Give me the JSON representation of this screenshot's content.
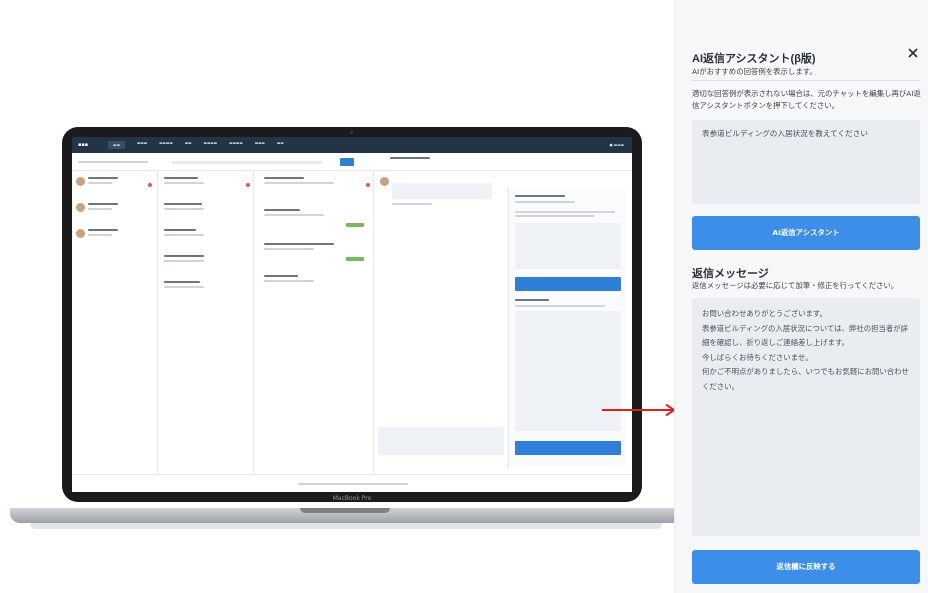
{
  "panel": {
    "title": "AI返信アシスタント(β版)",
    "subtitle": "AIがおすすめの回答例を表示します。",
    "notice": "適切な回答例が表示されない場合は、元のチャットを編集し再びAI返信アシスタントボタンを押下してください。",
    "question": "表参道ビルディングの入居状況を教えてください",
    "ai_button": "AI返信アシスタント",
    "reply_heading": "返信メッセージ",
    "reply_sub": "返信メッセージは必要に応じて加筆・修正を行ってください。",
    "reply_lines": [
      "お問い合わせありがとうございます。",
      "表参道ビルディングの入居状況については、弊社の担当者が詳細を確認し、折り返しご連絡差し上げます。",
      "今しばらくお待ちくださいませ。",
      "何かご不明点がありましたら、いつでもお気軽にお問い合わせください。"
    ],
    "reflect_button": "返信欄に反映する"
  },
  "laptop": {
    "label": "MacBook Pro"
  },
  "icons": {
    "close": "close-icon",
    "arrow": "arrow-right-icon"
  },
  "colors": {
    "accent": "#3d8ee8",
    "arrow": "#e02020",
    "app_header": "#243447"
  }
}
